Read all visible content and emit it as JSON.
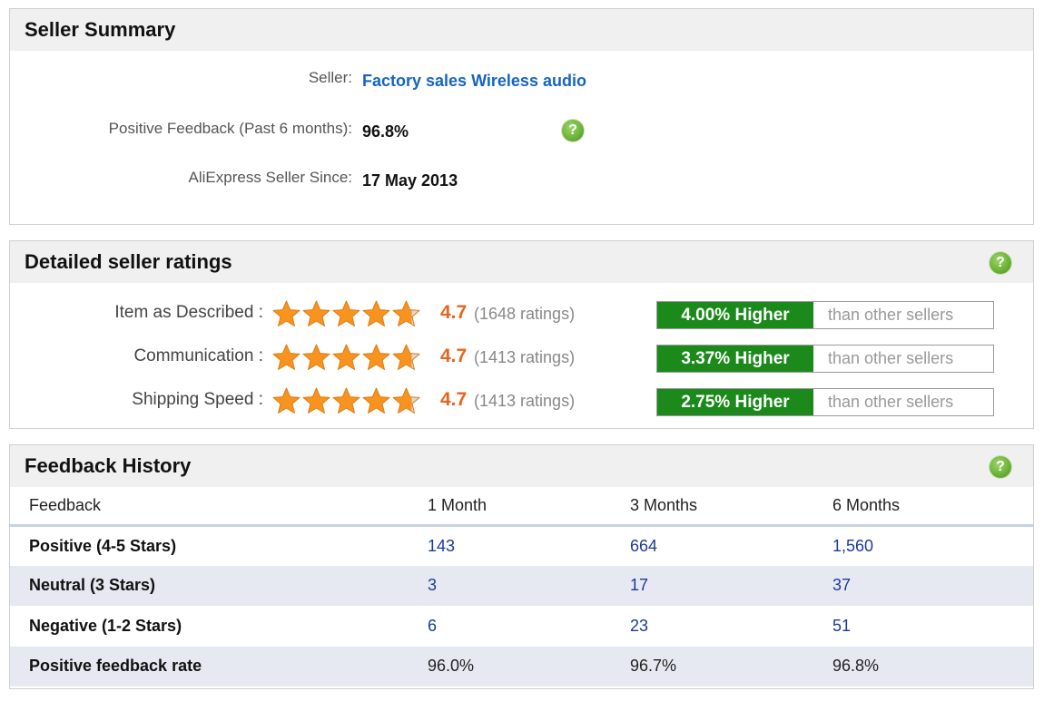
{
  "summary": {
    "title": "Seller Summary",
    "seller_label": "Seller:",
    "seller_name": "Factory sales Wireless audio",
    "positive_label": "Positive Feedback (Past 6 months):",
    "positive_value": "96.8%",
    "since_label": "AliExpress Seller Since:",
    "since_value": "17 May 2013",
    "help_icon": "question-icon"
  },
  "ratings": {
    "title": "Detailed seller ratings",
    "help_icon": "question-icon",
    "star_color": "#f7931e",
    "items": [
      {
        "label": "Item as Described :",
        "score": "4.7",
        "count": "(1648 ratings)",
        "compare": "4.00% Higher",
        "compare_suffix": "than other sellers",
        "stars": 4.7
      },
      {
        "label": "Communication :",
        "score": "4.7",
        "count": "(1413 ratings)",
        "compare": "3.37% Higher",
        "compare_suffix": "than other sellers",
        "stars": 4.7
      },
      {
        "label": "Shipping Speed :",
        "score": "4.7",
        "count": "(1413 ratings)",
        "compare": "2.75% Higher",
        "compare_suffix": "than other sellers",
        "stars": 4.7
      }
    ]
  },
  "history": {
    "title": "Feedback History",
    "help_icon": "question-icon",
    "headers": [
      "Feedback",
      "1 Month",
      "3 Months",
      "6 Months"
    ],
    "rows": [
      {
        "label": "Positive (4-5 Stars)",
        "values": [
          "143",
          "664",
          "1,560"
        ]
      },
      {
        "label": "Neutral (3 Stars)",
        "values": [
          "3",
          "17",
          "37"
        ]
      },
      {
        "label": "Negative (1-2 Stars)",
        "values": [
          "6",
          "23",
          "51"
        ]
      },
      {
        "label": "Positive feedback rate",
        "values": [
          "96.0%",
          "96.7%",
          "96.8%"
        ]
      }
    ]
  }
}
